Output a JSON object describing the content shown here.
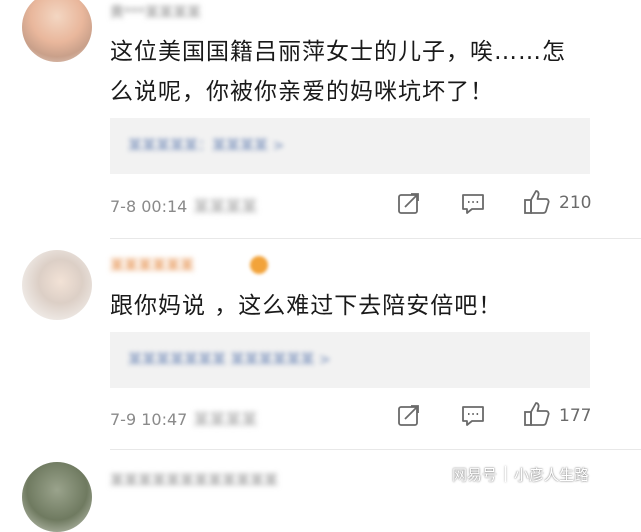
{
  "comments": [
    {
      "username": "黄***某某某某",
      "text_line1": "这位美国国籍吕丽萍女士的儿子，唉……怎",
      "text_line2": "么说呢，你被你亲爱的妈咪坑坏了！",
      "reply_preview": "某某某某某：某某某某 >",
      "time": "7-8 00:14",
      "location": "某某某某",
      "likes": "210"
    },
    {
      "username": "某某某某某某",
      "text_line1": "跟你妈说 ，这么难过下去陪安倍吧！",
      "reply_preview": "某某某某某某某 某某某某某某 >",
      "time": "7-9 10:47",
      "location": "某某某某",
      "likes": "177"
    },
    {
      "username": "某某某某某某某某某某某某"
    }
  ],
  "watermark": {
    "brand": "网易号",
    "author": "小彦人生路"
  },
  "icons": {
    "share": "share-icon",
    "comment": "comment-icon",
    "like": "thumbs-up-icon"
  },
  "colors": {
    "username_highlight": "#e07a2a",
    "reply_link": "#6b85b5",
    "meta": "#8a8a8a"
  }
}
